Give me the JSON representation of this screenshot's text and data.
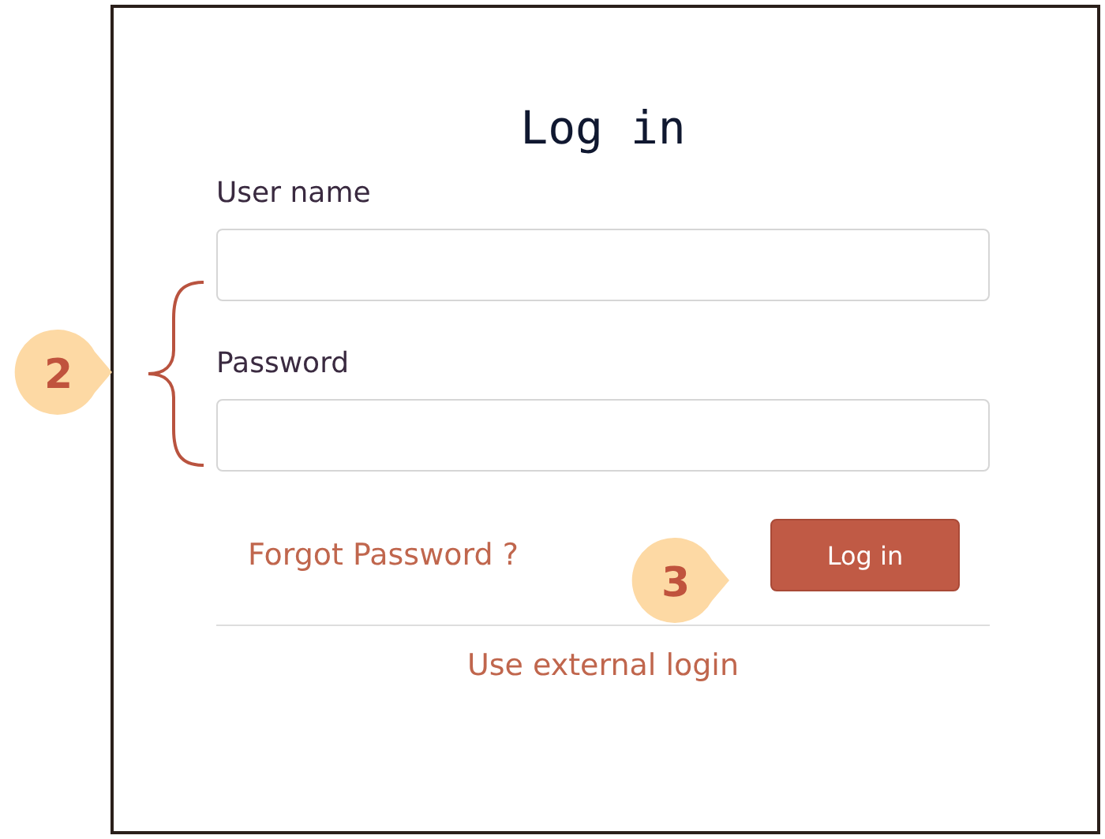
{
  "title": "Log in",
  "fields": [
    {
      "label": "User name"
    },
    {
      "label": "Password"
    }
  ],
  "forgot_link": "Forgot Password ?",
  "login_button": "Log in",
  "external_link": "Use external login",
  "callouts": [
    {
      "number": "2"
    },
    {
      "number": "3"
    }
  ]
}
